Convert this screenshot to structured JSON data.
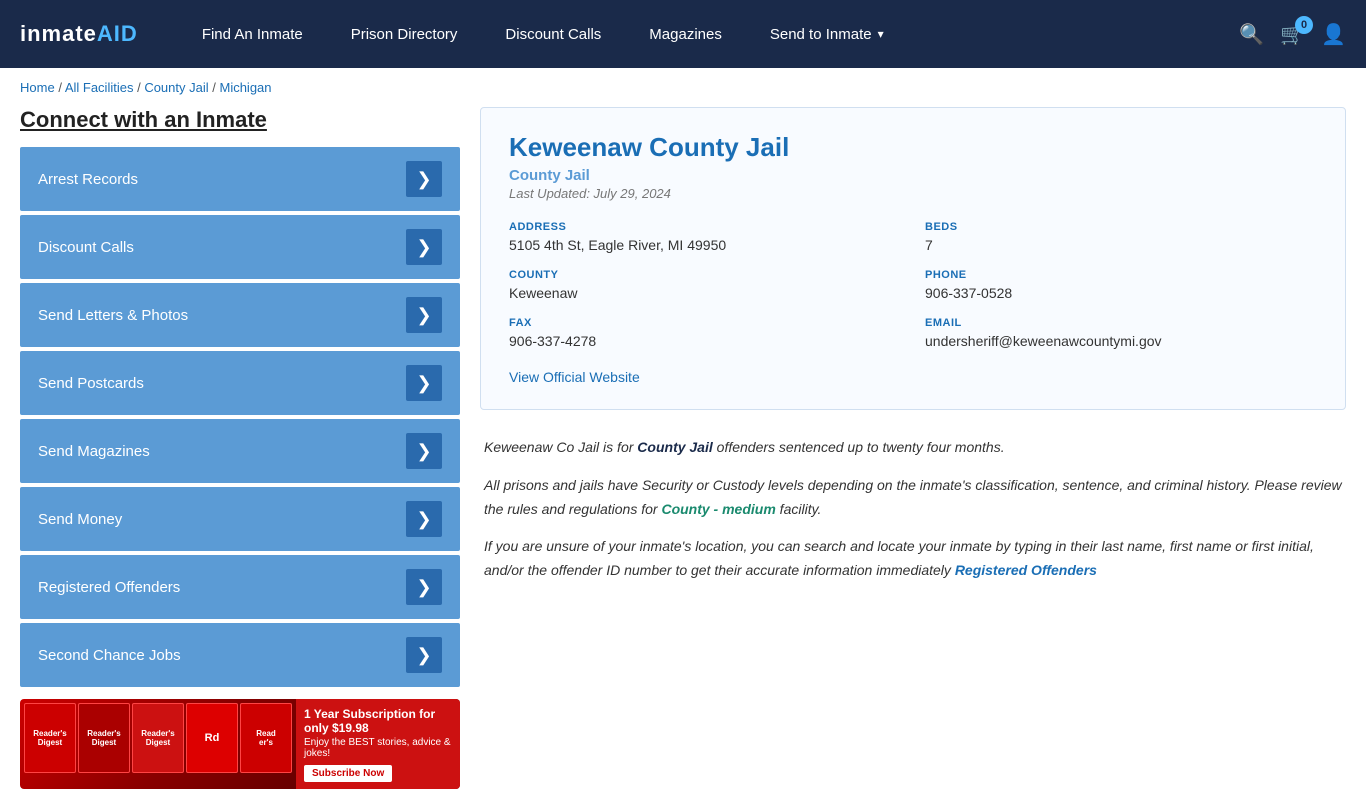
{
  "nav": {
    "logo": "inmateAID",
    "links": [
      {
        "id": "find-inmate",
        "label": "Find An Inmate"
      },
      {
        "id": "prison-directory",
        "label": "Prison Directory"
      },
      {
        "id": "discount-calls",
        "label": "Discount Calls"
      },
      {
        "id": "magazines",
        "label": "Magazines"
      },
      {
        "id": "send-to-inmate",
        "label": "Send to Inmate",
        "dropdown": true
      }
    ],
    "cart_count": "0",
    "icons": {
      "search": "🔍",
      "cart": "🛒",
      "user": "👤"
    }
  },
  "breadcrumb": {
    "items": [
      {
        "label": "Home",
        "href": "#"
      },
      {
        "label": "All Facilities",
        "href": "#"
      },
      {
        "label": "County Jail",
        "href": "#"
      },
      {
        "label": "Michigan",
        "href": "#"
      }
    ]
  },
  "sidebar": {
    "title": "Connect with an Inmate",
    "buttons": [
      {
        "id": "arrest-records",
        "label": "Arrest Records"
      },
      {
        "id": "discount-calls",
        "label": "Discount Calls"
      },
      {
        "id": "send-letters-photos",
        "label": "Send Letters & Photos"
      },
      {
        "id": "send-postcards",
        "label": "Send Postcards"
      },
      {
        "id": "send-magazines",
        "label": "Send Magazines"
      },
      {
        "id": "send-money",
        "label": "Send Money"
      },
      {
        "id": "registered-offenders",
        "label": "Registered Offenders"
      },
      {
        "id": "second-chance-jobs",
        "label": "Second Chance Jobs"
      }
    ],
    "ad": {
      "title": "1 Year Subscription for only $19.98",
      "subtitle": "Enjoy the BEST stories, advice & jokes!",
      "button_label": "Subscribe Now"
    }
  },
  "facility": {
    "name": "Keweenaw County Jail",
    "type": "County Jail",
    "last_updated": "Last Updated: July 29, 2024",
    "address_label": "ADDRESS",
    "address_value": "5105 4th St, Eagle River, MI 49950",
    "beds_label": "BEDS",
    "beds_value": "7",
    "county_label": "COUNTY",
    "county_value": "Keweenaw",
    "phone_label": "PHONE",
    "phone_value": "906-337-0528",
    "fax_label": "FAX",
    "fax_value": "906-337-4278",
    "email_label": "EMAIL",
    "email_value": "undersheriff@keweenawcountymi.gov",
    "website_label": "View Official Website"
  },
  "description": {
    "p1": "Keweenaw Co Jail is for County Jail offenders sentenced up to twenty four months.",
    "p1_link_text": "County Jail",
    "p2": "All prisons and jails have Security or Custody levels depending on the inmate's classification, sentence, and criminal history. Please review the rules and regulations for County - medium facility.",
    "p2_link_text": "County - medium",
    "p3": "If you are unsure of your inmate's location, you can search and locate your inmate by typing in their last name, first name or first initial, and/or the offender ID number to get their accurate information immediately",
    "p3_link_text": "Registered Offenders"
  }
}
